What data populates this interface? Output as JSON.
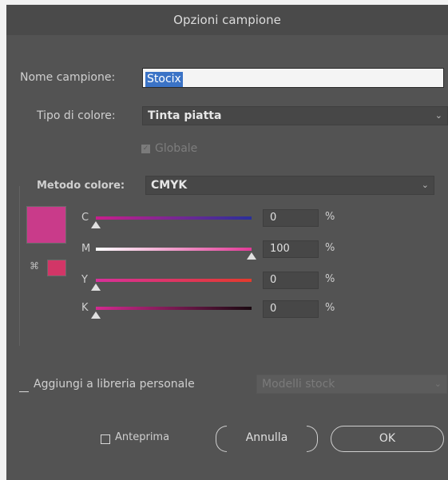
{
  "dialog": {
    "title": "Opzioni campione"
  },
  "name": {
    "label": "Nome campione:",
    "value": "Stocix"
  },
  "color_type": {
    "label": "Tipo di colore:",
    "value": "Tinta piatta"
  },
  "global": {
    "label": "Globale",
    "checked": true,
    "disabled": true
  },
  "color_mode": {
    "label": "Metodo colore:",
    "value": "CMYK"
  },
  "swatch_color": "#c93b8a",
  "gamut_color": "#d23667",
  "sliders": [
    {
      "letter": "C",
      "value": "0",
      "unit": "%"
    },
    {
      "letter": "M",
      "value": "100",
      "unit": "%"
    },
    {
      "letter": "Y",
      "value": "0",
      "unit": "%"
    },
    {
      "letter": "K",
      "value": "0",
      "unit": "%"
    }
  ],
  "library": {
    "label": "Aggiungi a libreria personale",
    "checked": false,
    "dropdown_value": "Modelli stock"
  },
  "footer": {
    "preview_label": "Anteprima",
    "cancel_label": "Annulla",
    "ok_label": "OK"
  }
}
